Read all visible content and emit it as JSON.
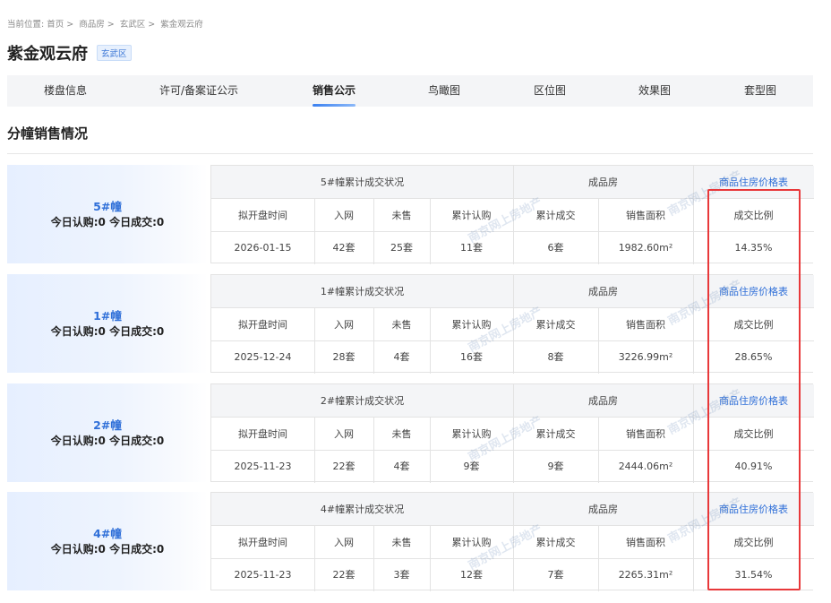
{
  "breadcrumb": {
    "label": "当前位置:",
    "items": [
      "首页",
      "商品房",
      "玄武区",
      "紫金观云府"
    ],
    "separator": ">"
  },
  "project": {
    "name": "紫金观云府",
    "district": "玄武区"
  },
  "tabs": [
    "楼盘信息",
    "许可/备案证公示",
    "销售公示",
    "鸟瞰图",
    "区位图",
    "效果图",
    "套型图"
  ],
  "active_tab": "销售公示",
  "section_title": "分幢销售情况",
  "table_headers": {
    "finished": "成品房",
    "price_link": "商品住房价格表",
    "columns": [
      "拟开盘时间",
      "入网",
      "未售",
      "累计认购",
      "累计成交",
      "销售面积",
      "成交比例"
    ]
  },
  "buildings": [
    {
      "name": "5#幢",
      "today": "今日认购:0 今日成交:0",
      "cumulative_title": "5#幢累计成交状况",
      "row": [
        "2026-01-15",
        "42套",
        "25套",
        "11套",
        "6套",
        "1982.60m²",
        "14.35%"
      ]
    },
    {
      "name": "1#幢",
      "today": "今日认购:0 今日成交:0",
      "cumulative_title": "1#幢累计成交状况",
      "row": [
        "2025-12-24",
        "28套",
        "4套",
        "16套",
        "8套",
        "3226.99m²",
        "28.65%"
      ]
    },
    {
      "name": "2#幢",
      "today": "今日认购:0 今日成交:0",
      "cumulative_title": "2#幢累计成交状况",
      "row": [
        "2025-11-23",
        "22套",
        "4套",
        "9套",
        "9套",
        "2444.06m²",
        "40.91%"
      ]
    },
    {
      "name": "4#幢",
      "today": "今日认购:0 今日成交:0",
      "cumulative_title": "4#幢累计成交状况",
      "row": [
        "2025-11-23",
        "22套",
        "3套",
        "12套",
        "7套",
        "2265.31m²",
        "31.54%"
      ]
    }
  ],
  "watermark": "南京网上房地产",
  "colors": {
    "accent": "#2f6fd8",
    "highlight_box": "#e8383a",
    "header_bg": "#f4f5f7"
  }
}
